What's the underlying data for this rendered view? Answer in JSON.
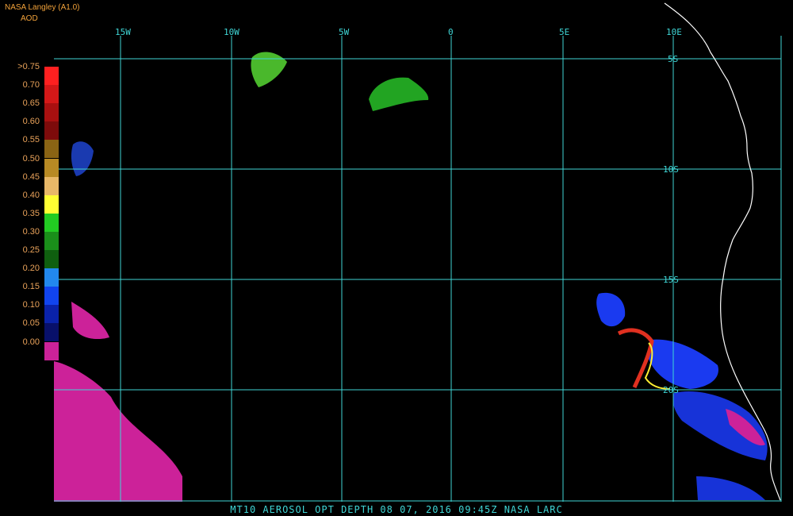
{
  "header": {
    "source": "NASA Langley (A1.0)",
    "product": "AOD"
  },
  "legend": {
    "items": [
      {
        "label": ">0.75",
        "color": "#ff2020"
      },
      {
        "label": "0.70",
        "color": "#d41818"
      },
      {
        "label": "0.65",
        "color": "#a81010"
      },
      {
        "label": "0.60",
        "color": "#7d0b0b"
      },
      {
        "label": "0.55",
        "color": "#8a6414"
      },
      {
        "label": "0.50",
        "color": "#b88a24"
      },
      {
        "label": "0.45",
        "color": "#e8b868"
      },
      {
        "label": "0.40",
        "color": "#ffff33"
      },
      {
        "label": "0.35",
        "color": "#22cc22"
      },
      {
        "label": "0.30",
        "color": "#1a8f1a"
      },
      {
        "label": "0.25",
        "color": "#0f5f0f"
      },
      {
        "label": "0.20",
        "color": "#2288ee"
      },
      {
        "label": "0.15",
        "color": "#1144ee"
      },
      {
        "label": "0.10",
        "color": "#0a22aa"
      },
      {
        "label": "0.05",
        "color": "#08106a"
      },
      {
        "label": "0.00",
        "color": "#cc2299"
      }
    ]
  },
  "grid": {
    "lon_labels": [
      "15W",
      "10W",
      "5W",
      "0",
      "5E",
      "10E"
    ],
    "lat_labels": [
      "5S",
      "10S",
      "15S",
      "20S"
    ],
    "line_color": "#3fd5d5"
  },
  "footer": {
    "caption": "MT10  AEROSOL OPT DEPTH   08 07, 2016 09:45Z   NASA LARC"
  }
}
